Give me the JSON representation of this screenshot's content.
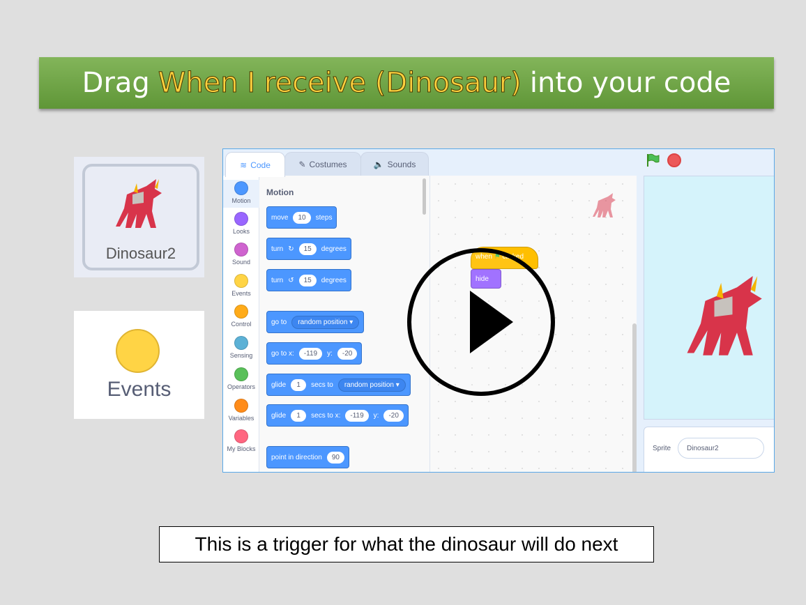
{
  "banner": {
    "prefix": "Drag",
    "highlight": "When I receive (Dinosaur)",
    "suffix": "into your code"
  },
  "sprite_card": {
    "name": "Dinosaur2",
    "icon": "dinosaur-sprite-icon"
  },
  "events_card": {
    "label": "Events",
    "color": "#ffd445"
  },
  "editor": {
    "tabs": [
      {
        "label": "Code",
        "icon": "code-icon"
      },
      {
        "label": "Costumes",
        "icon": "brush-icon"
      },
      {
        "label": "Sounds",
        "icon": "speaker-icon"
      }
    ],
    "categories": [
      {
        "label": "Motion",
        "color": "#4c97ff"
      },
      {
        "label": "Looks",
        "color": "#9966ff"
      },
      {
        "label": "Sound",
        "color": "#cf63cf"
      },
      {
        "label": "Events",
        "color": "#ffd445"
      },
      {
        "label": "Control",
        "color": "#ffab19"
      },
      {
        "label": "Sensing",
        "color": "#5cb1d6"
      },
      {
        "label": "Operators",
        "color": "#59c059"
      },
      {
        "label": "Variables",
        "color": "#ff8c1a"
      },
      {
        "label": "My Blocks",
        "color": "#ff6680"
      }
    ],
    "palette_title": "Motion",
    "blocks": {
      "move": {
        "a": "move",
        "v": "10",
        "b": "steps"
      },
      "turn_right": {
        "a": "turn",
        "v": "15",
        "b": "degrees"
      },
      "turn_left": {
        "a": "turn",
        "v": "15",
        "b": "degrees"
      },
      "goto": {
        "a": "go to",
        "menu": "random position"
      },
      "goto_xy": {
        "a": "go to x:",
        "x": "-119",
        "b": "y:",
        "y": "-20"
      },
      "glide": {
        "a": "glide",
        "v": "1",
        "b": "secs to",
        "menu": "random position"
      },
      "glide_xy": {
        "a": "glide",
        "v": "1",
        "b": "secs to x:",
        "x": "-119",
        "c": "y:",
        "y": "-20"
      },
      "point": {
        "a": "point in direction",
        "v": "90"
      }
    },
    "workspace": {
      "hat_when": "when",
      "hat_clicked": "clicked",
      "hide": "hide"
    },
    "sprite_pane": {
      "label": "Sprite",
      "name": "Dinosaur2"
    }
  },
  "caption": "This is a trigger for what the dinosaur will do next",
  "colors": {
    "motion": "#4c97ff",
    "events": "#ffbf00",
    "looks": "#9966ff",
    "banner": "#6fa647"
  }
}
